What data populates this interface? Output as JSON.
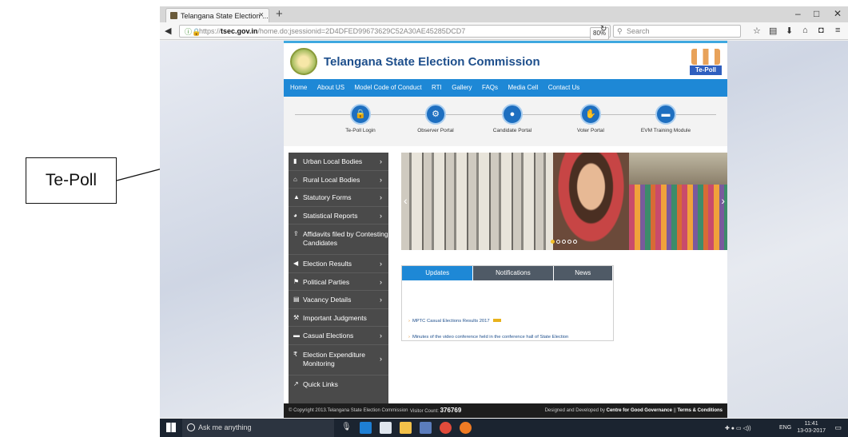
{
  "annotation": {
    "callout_text": "Te-Poll"
  },
  "browser": {
    "tab_title": "Telangana State Election ...",
    "tab_close": "×",
    "new_tab": "+",
    "url_scheme": "https://",
    "url_host": "tsec.gov.in",
    "url_path": "/home.do;jsessionid=2D4DFED99673629C52A30AE45285DCD7",
    "zoom": "80%",
    "search_placeholder": "Search",
    "window_controls": {
      "minimize": "–",
      "maximize": "□",
      "close": "✕"
    }
  },
  "site": {
    "title": "Telangana State Election Commission",
    "logo_label": "Te-Poll",
    "menu": [
      "Home",
      "About US",
      "Model Code of Conduct",
      "RTI",
      "Gallery",
      "FAQs",
      "Media Cell",
      "Contact Us"
    ],
    "portals": [
      {
        "label": "Te-Poll Login",
        "icon": "lock-icon"
      },
      {
        "label": "Observer Portal",
        "icon": "gear-icon"
      },
      {
        "label": "Candidate Portal",
        "icon": "user-icon"
      },
      {
        "label": "Voter Portal",
        "icon": "hand-icon"
      },
      {
        "label": "EVM Training Module",
        "icon": "monitor-icon"
      }
    ],
    "sidebar": [
      {
        "label": "Urban Local Bodies",
        "icon": "building-icon",
        "chevron": true
      },
      {
        "label": "Rural Local Bodies",
        "icon": "home-icon",
        "chevron": true
      },
      {
        "label": "Statutory Forms",
        "icon": "warning-icon",
        "chevron": true
      },
      {
        "label": "Statistical Reports",
        "icon": "pie-chart-icon",
        "chevron": true
      },
      {
        "label": "Affidavits filed by Contesting Candidates",
        "icon": "upload-icon",
        "chevron": false
      },
      {
        "label": "Election Results",
        "icon": "megaphone-icon",
        "chevron": true
      },
      {
        "label": "Political Parties",
        "icon": "flag-icon",
        "chevron": true
      },
      {
        "label": "Vacancy Details",
        "icon": "document-icon",
        "chevron": true
      },
      {
        "label": "Important Judgments",
        "icon": "gavel-icon",
        "chevron": false
      },
      {
        "label": "Casual Elections",
        "icon": "briefcase-icon",
        "chevron": true
      },
      {
        "label": "Election Expenditure Monitoring",
        "icon": "rupee-icon",
        "chevron": true
      },
      {
        "label": "Quick Links",
        "icon": "external-link-icon",
        "chevron": false
      }
    ],
    "news_tabs": [
      "Updates",
      "Notifications",
      "News"
    ],
    "news_items": [
      "MPTC Casual Elections Results 2017",
      "Minutes of the video conference held in the conference hall of State Election"
    ],
    "footer": {
      "copyright": "© Copyright 2013.Telangana State Election Commission",
      "visitor_label": "Visitor Count:",
      "visitor_count": "376769",
      "developed_prefix": "Designed and Developed by",
      "developer": "Centre for Good Governance",
      "terms": "Terms & Conditions"
    }
  },
  "taskbar": {
    "search_placeholder": "Ask me anything",
    "language": "ENG",
    "time": "11:41",
    "date": "13-03-2017"
  }
}
